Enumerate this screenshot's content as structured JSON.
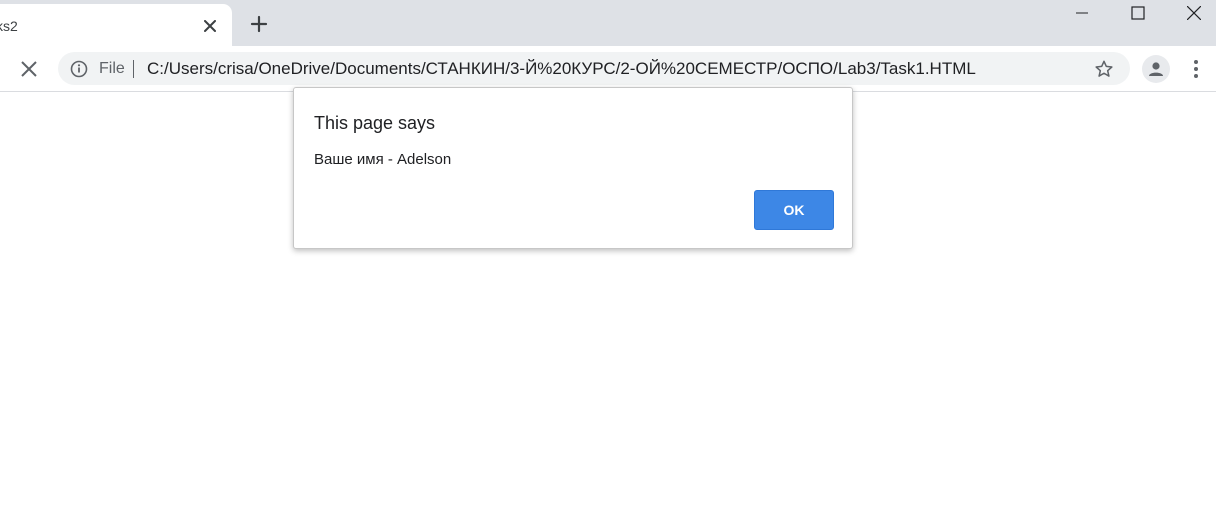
{
  "tab": {
    "title": "ks2"
  },
  "address_bar": {
    "scheme_label": "File",
    "url": "C:/Users/crisa/OneDrive/Documents/СТАНКИН/3-Й%20КУРС/2-ОЙ%20СЕМЕСТР/ОСПО/Lab3/Task1.HTML"
  },
  "dialog": {
    "title": "This page says",
    "message": "Ваше имя - Adelson",
    "ok_label": "OK"
  },
  "colors": {
    "tabstrip_bg": "#dee1e6",
    "accent": "#3d87e6"
  },
  "icons": [
    "close-icon",
    "plus-icon",
    "minimize-icon",
    "maximize-icon",
    "window-close-icon",
    "stop-icon",
    "info-icon",
    "star-icon",
    "profile-icon",
    "more-vert-icon"
  ]
}
